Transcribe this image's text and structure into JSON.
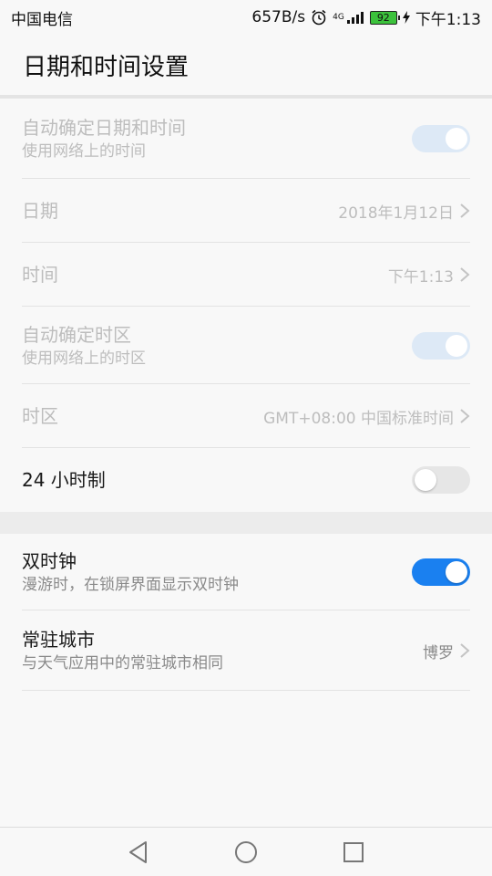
{
  "status_bar": {
    "carrier": "中国电信",
    "net_speed": "657B/s",
    "network_label": "4G",
    "battery": "92",
    "time": "下午1:13",
    "icons": [
      "alarm-icon",
      "signal-icon",
      "battery-icon",
      "charging-icon"
    ]
  },
  "app_bar": {
    "title": "日期和时间设置"
  },
  "settings": {
    "auto_datetime": {
      "title": "自动确定日期和时间",
      "subtitle": "使用网络上的时间",
      "enabled": true,
      "disabled": true
    },
    "date": {
      "title": "日期",
      "value": "2018年1月12日"
    },
    "time": {
      "title": "时间",
      "value": "下午1:13"
    },
    "auto_timezone": {
      "title": "自动确定时区",
      "subtitle": "使用网络上的时区",
      "enabled": true,
      "disabled": true
    },
    "timezone": {
      "title": "时区",
      "value": "GMT+08:00 中国标准时间"
    },
    "hour24": {
      "title": "24 小时制",
      "enabled": false
    },
    "dual_clock": {
      "title": "双时钟",
      "subtitle": "漫游时，在锁屏界面显示双时钟",
      "enabled": true
    },
    "home_city": {
      "title": "常驻城市",
      "subtitle": "与天气应用中的常驻城市相同",
      "value": "博罗"
    }
  },
  "colors": {
    "accent": "#1a80f0",
    "disabled_text": "#bdbdbd",
    "background": "#f8f8f8"
  },
  "nav_bar": {
    "icons": [
      "back-icon",
      "home-icon",
      "recents-icon"
    ]
  }
}
